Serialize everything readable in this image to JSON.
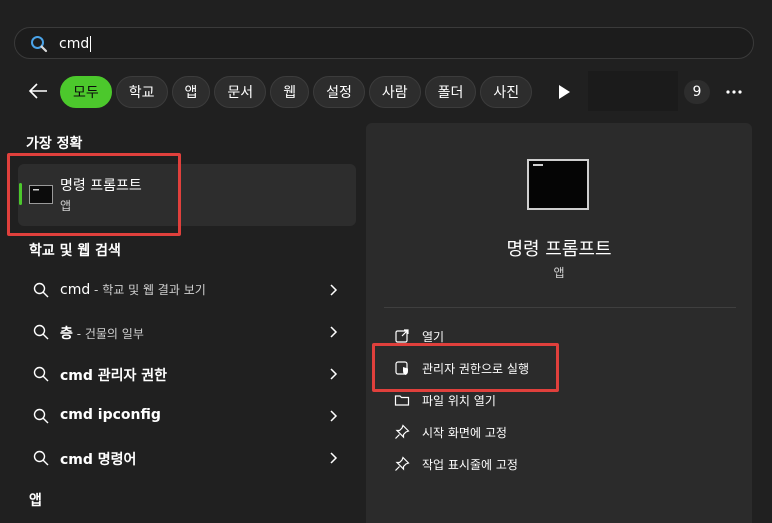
{
  "search": {
    "value": "cmd"
  },
  "filters": {
    "chips": [
      "모두",
      "학교",
      "앱",
      "문서",
      "웹",
      "설정",
      "사람",
      "폴더",
      "사진"
    ],
    "count": "9"
  },
  "best_match": {
    "heading": "가장 정확",
    "name": "명령 프롬프트",
    "type": "앱"
  },
  "web_search": {
    "heading": "학교 및 웹 검색",
    "rows": [
      {
        "bold": "cmd",
        "sub": " - 학교 및 웹 결과 보기"
      },
      {
        "bold": "층",
        "sub": " - 건물의 일부"
      },
      {
        "bold": "cmd 관리자 권한",
        "sub": ""
      },
      {
        "bold": "cmd ipconfig",
        "sub": ""
      },
      {
        "bold": "cmd 명령어",
        "sub": ""
      }
    ]
  },
  "apps_heading": "앱",
  "detail": {
    "name": "명령 프롬프트",
    "type": "앱",
    "actions": [
      {
        "label": "열기",
        "icon": "open-external-icon"
      },
      {
        "label": "관리자 권한으로 실행",
        "icon": "shield-admin-icon"
      },
      {
        "label": "파일 위치 열기",
        "icon": "folder-icon"
      },
      {
        "label": "시작 화면에 고정",
        "icon": "pin-icon"
      },
      {
        "label": "작업 표시줄에 고정",
        "icon": "pin-icon"
      }
    ]
  },
  "colors": {
    "accent": "#4cc82c",
    "highlight": "#e0403c",
    "background": "#202020",
    "panel": "#2b2b2b"
  }
}
